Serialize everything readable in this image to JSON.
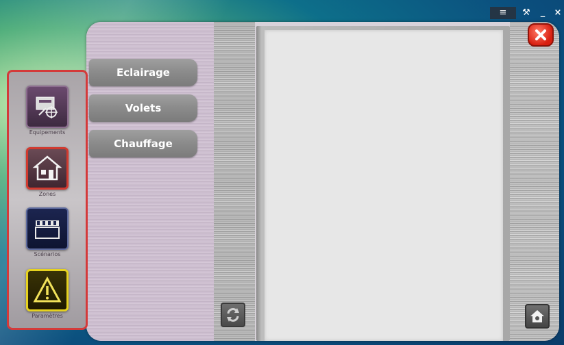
{
  "window": {
    "controls": {
      "menu_glyph": "≡",
      "tools_glyph": "⚒",
      "minimize_glyph": "_",
      "close_glyph": "×"
    }
  },
  "menu": {
    "items": [
      {
        "label": "Eclairage"
      },
      {
        "label": "Volets"
      },
      {
        "label": "Chauffage"
      }
    ]
  },
  "sidebar": {
    "items": [
      {
        "label": "Equipements",
        "icon": "equipment-icon"
      },
      {
        "label": "Zones",
        "icon": "house-icon"
      },
      {
        "label": "Scénarios",
        "icon": "clapperboard-icon"
      },
      {
        "label": "Paramètres",
        "icon": "warning-icon"
      }
    ]
  },
  "colors": {
    "accent_red": "#d43a3a",
    "param_yellow": "#e6d21f"
  }
}
